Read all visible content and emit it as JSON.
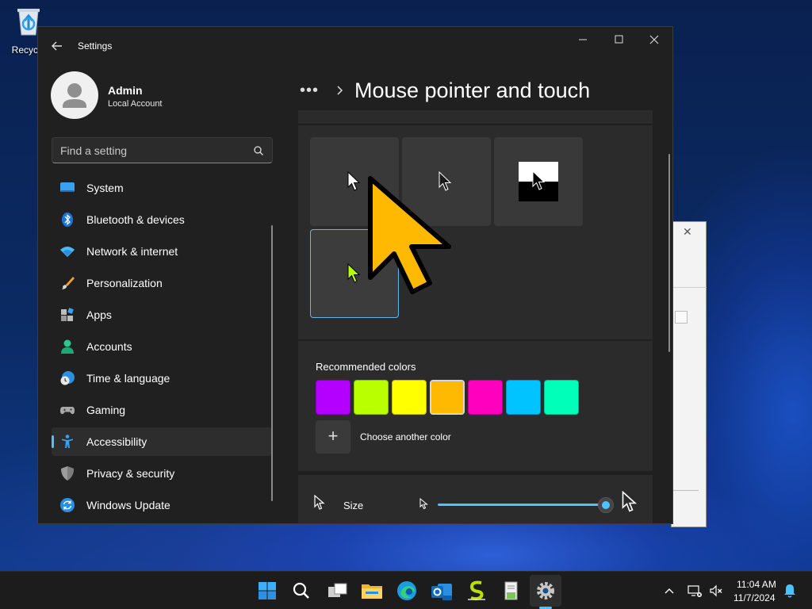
{
  "desktop": {
    "recycle_bin_label": "Recycle"
  },
  "window": {
    "title": "Settings",
    "controls": [
      "minimize-icon",
      "maximize-icon",
      "close-icon"
    ]
  },
  "profile": {
    "name": "Admin",
    "account_type": "Local Account"
  },
  "search": {
    "placeholder": "Find a setting",
    "icon": "search-icon"
  },
  "sidebar": {
    "items": [
      {
        "label": "System",
        "icon": "system-icon"
      },
      {
        "label": "Bluetooth & devices",
        "icon": "bluetooth-icon"
      },
      {
        "label": "Network & internet",
        "icon": "wifi-icon"
      },
      {
        "label": "Personalization",
        "icon": "brush-icon"
      },
      {
        "label": "Apps",
        "icon": "apps-icon"
      },
      {
        "label": "Accounts",
        "icon": "person-icon"
      },
      {
        "label": "Time & language",
        "icon": "clock-globe-icon"
      },
      {
        "label": "Gaming",
        "icon": "gamepad-icon"
      },
      {
        "label": "Accessibility",
        "icon": "accessibility-icon",
        "active": true
      },
      {
        "label": "Privacy & security",
        "icon": "shield-icon"
      },
      {
        "label": "Windows Update",
        "icon": "update-icon"
      }
    ]
  },
  "content": {
    "breadcrumb_more": "•••",
    "page_title": "Mouse pointer and touch",
    "pointer_styles": [
      {
        "name": "white"
      },
      {
        "name": "black"
      },
      {
        "name": "inverted"
      },
      {
        "name": "custom",
        "selected": true
      }
    ],
    "colors": {
      "heading": "Recommended colors",
      "swatches": [
        "#b300ff",
        "#b9ff00",
        "#ffff00",
        "#ffb900",
        "#ff00bf",
        "#00c3ff",
        "#00ffb9"
      ],
      "selected_index": 3,
      "choose_label": "Choose another color",
      "add_symbol": "+"
    },
    "size": {
      "label": "Size",
      "value_fraction": 1.0
    },
    "accent_color": "#4cc2ff",
    "pointer_color": "#ffb900"
  },
  "taskbar": {
    "apps": [
      "start-icon",
      "search-icon",
      "task-view-icon",
      "file-explorer-icon",
      "edge-icon",
      "outlook-icon",
      "sketch-app-icon",
      "notepad-app-icon",
      "settings-icon"
    ],
    "active_app": "settings-icon",
    "time": "11:04 AM",
    "date": "11/7/2024"
  }
}
